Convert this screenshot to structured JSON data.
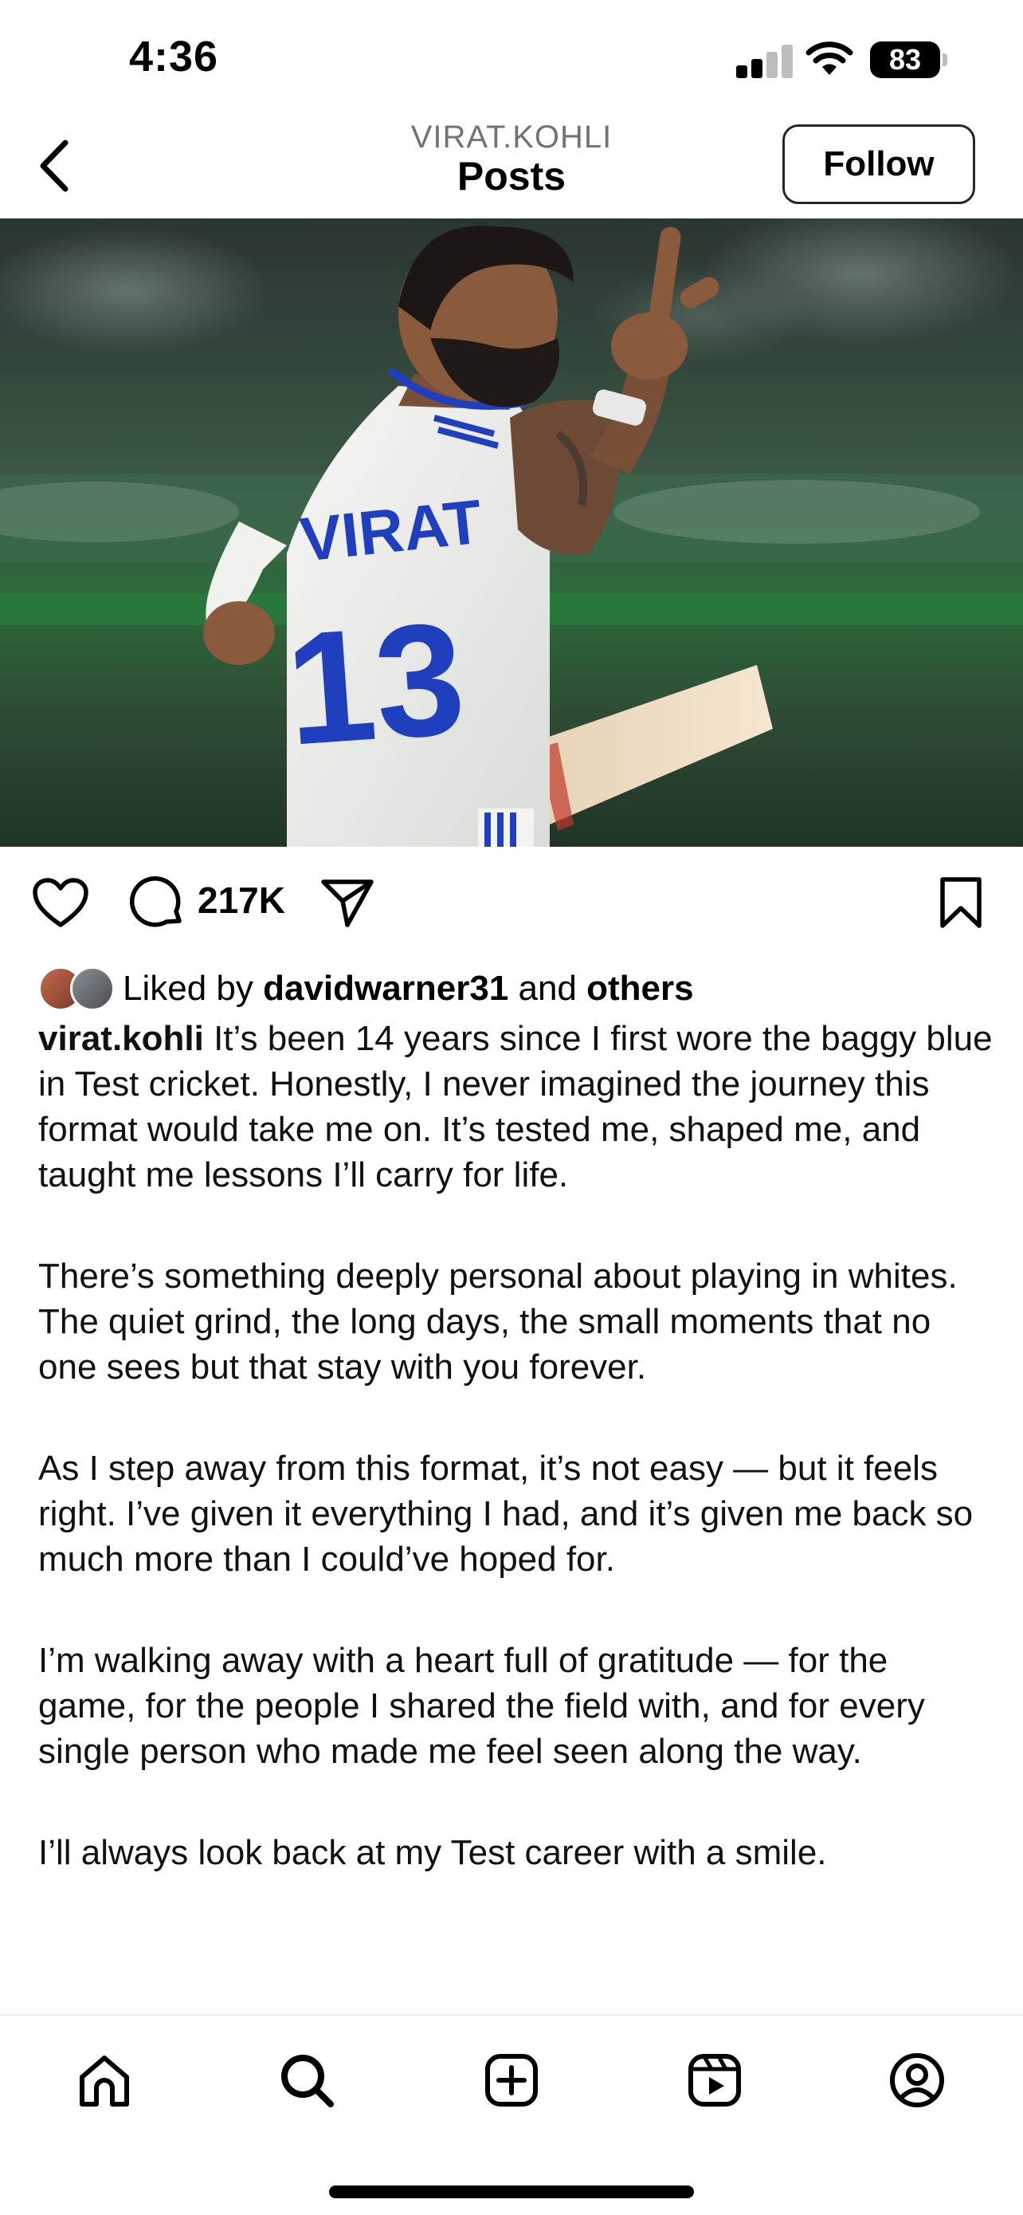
{
  "status_bar": {
    "time": "4:36",
    "battery": "83"
  },
  "header": {
    "username": "VIRAT.KOHLI",
    "title": "Posts",
    "follow_label": "Follow"
  },
  "post": {
    "image_alt": "Cricketer in white Test jersey number 13 raising his finger while holding a bat",
    "jersey_text": "VIRAT",
    "jersey_number": "13",
    "comment_count": "217K",
    "liked_by_prefix": "Liked by ",
    "liked_by_user": "davidwarner31",
    "liked_by_and": " and ",
    "liked_by_others": "others",
    "caption_user": "virat.kohli",
    "caption_paragraphs": [
      "It’s been 14 years since I first wore the baggy blue in Test cricket. Honestly, I never imagined the journey this format would take me on. It’s tested me, shaped me, and taught me lessons I’ll carry for life.",
      "There’s something deeply personal about playing in whites. The quiet grind, the long days, the small moments that no one sees but that stay with you forever.",
      "As I step away from this format, it’s not easy — but it feels right. I’ve given it everything I had, and it’s given me back so much more than I could’ve hoped for.",
      "I’m walking away with a heart full of gratitude — for the game, for the people I shared the field with, and for every single person who made me feel seen along the way.",
      "I’ll always look back at my Test career with a smile."
    ]
  },
  "icons": {
    "back": "chevron-left-icon",
    "like": "heart-icon",
    "comment": "comment-icon",
    "share": "paper-plane-icon",
    "save": "bookmark-icon",
    "mute": "speaker-muted-icon"
  },
  "bottom_nav": [
    "home-icon",
    "search-icon",
    "create-icon",
    "reels-icon",
    "profile-icon"
  ],
  "colors": {
    "jersey_blue": "#1f3fbf",
    "field_green": "#2f5b3a",
    "muted_text": "#737373"
  }
}
